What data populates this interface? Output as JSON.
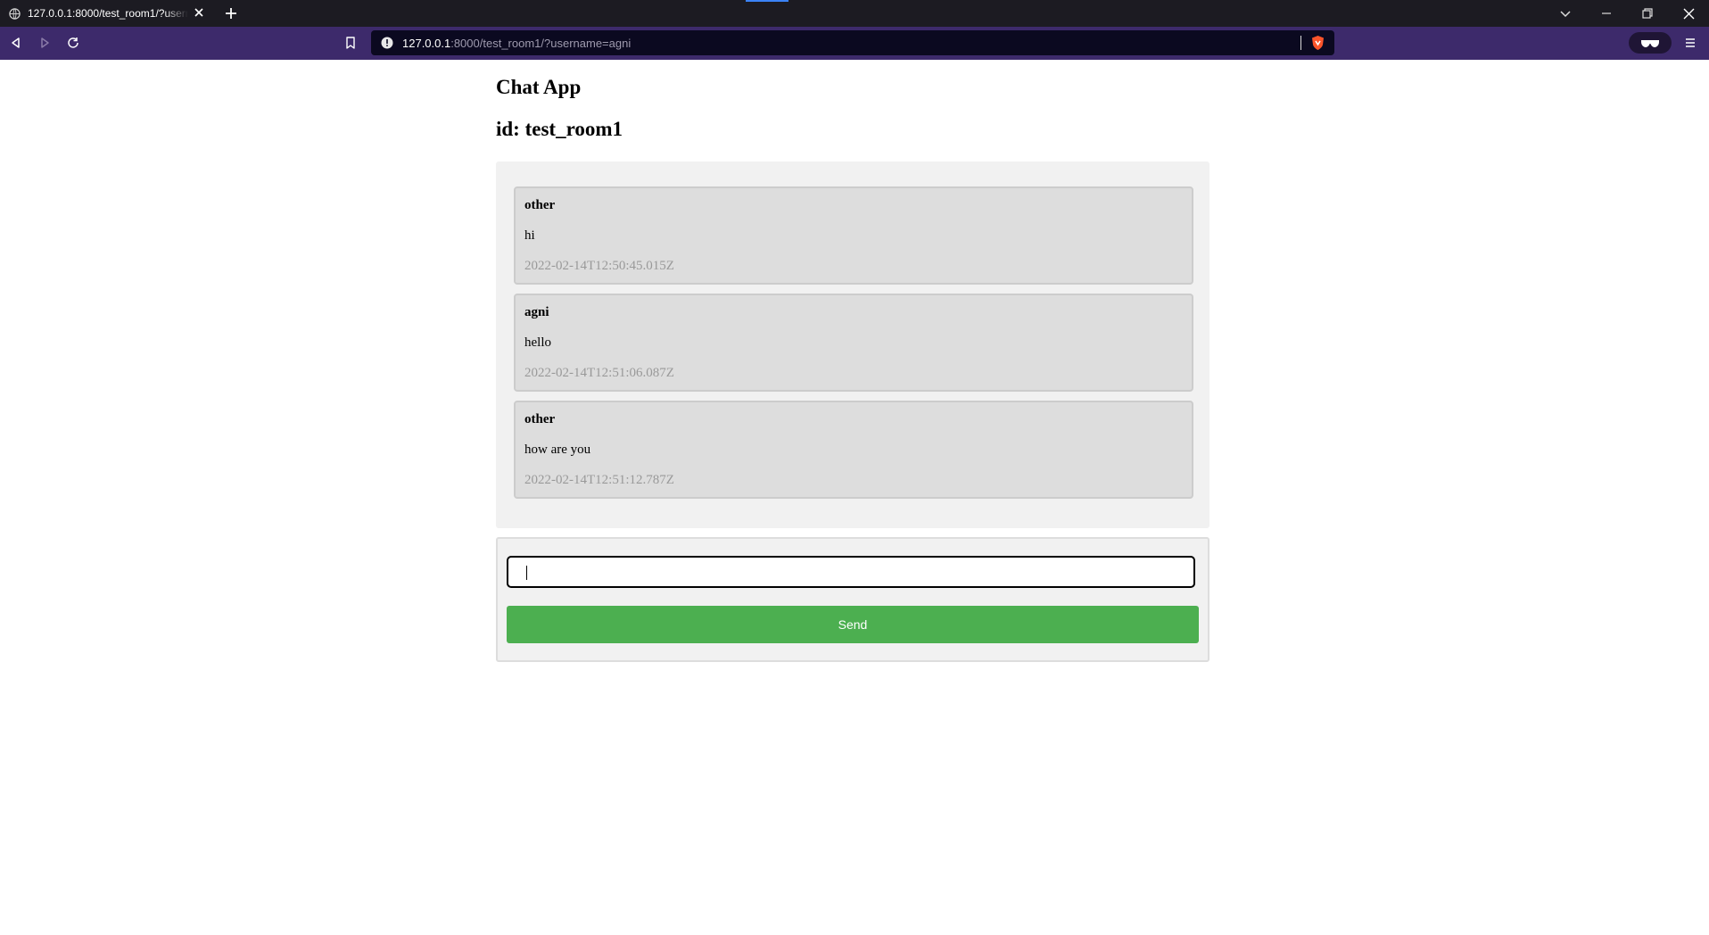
{
  "browser": {
    "tab_title": "127.0.0.1:8000/test_room1/?username=agni",
    "url_host": "127.0.0.1",
    "url_rest": ":8000/test_room1/?username=agni",
    "accent": "#3d2a6b"
  },
  "page": {
    "title": "Chat App",
    "room_id": "id: test_room1"
  },
  "messages": [
    {
      "user": "other",
      "text": "hi",
      "time": "2022-02-14T12:50:45.015Z"
    },
    {
      "user": "agni",
      "text": "hello",
      "time": "2022-02-14T12:51:06.087Z"
    },
    {
      "user": "other",
      "text": "how are you",
      "time": "2022-02-14T12:51:12.787Z"
    }
  ],
  "composer": {
    "input_value": "",
    "send_label": "Send",
    "send_color": "#4caf50"
  }
}
